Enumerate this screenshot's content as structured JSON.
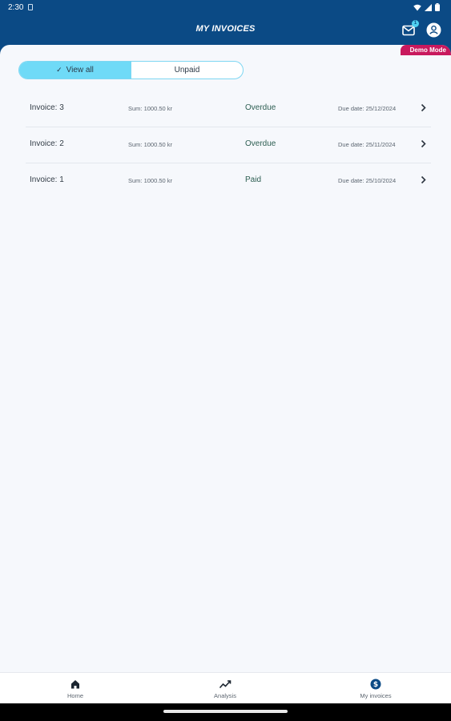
{
  "status_bar": {
    "time": "2:30"
  },
  "app_bar": {
    "title": "MY INVOICES",
    "notification_count": "1"
  },
  "demo_badge": "Demo Mode",
  "filter": {
    "options": [
      {
        "label": "View all",
        "selected": true
      },
      {
        "label": "Unpaid",
        "selected": false
      }
    ]
  },
  "invoices": [
    {
      "title": "Invoice: 3",
      "sum": "Sum: 1000.50 kr",
      "status": "Overdue",
      "due": "Due date: 25/12/2024"
    },
    {
      "title": "Invoice: 2",
      "sum": "Sum: 1000.50 kr",
      "status": "Overdue",
      "due": "Due date: 25/11/2024"
    },
    {
      "title": "Invoice: 1",
      "sum": "Sum: 1000.50 kr",
      "status": "Paid",
      "due": "Due date: 25/10/2024"
    }
  ],
  "bottom_nav": [
    {
      "label": "Home",
      "icon": "home-icon"
    },
    {
      "label": "Analysis",
      "icon": "trend-icon"
    },
    {
      "label": "My invoices",
      "icon": "dollar-icon"
    }
  ],
  "colors": {
    "primary": "#0b4a85",
    "accent": "#6fdaf7",
    "demo": "#c8195d",
    "background": "#f6f8fc"
  }
}
